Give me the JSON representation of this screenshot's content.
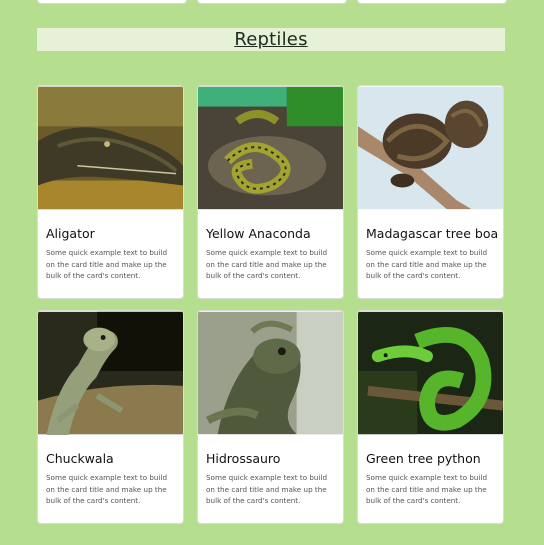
{
  "section": {
    "title": "Reptiles"
  },
  "cards": [
    {
      "title": "Aligator",
      "text": "Some quick example text to build on the card title and make up the bulk of the card's content.",
      "image": "alligator-photo"
    },
    {
      "title": "Yellow Anaconda",
      "text": "Some quick example text to build on the card title and make up the bulk of the card's content.",
      "image": "anaconda-photo"
    },
    {
      "title": "Madagascar tree boa",
      "text": "Some quick example text to build on the card title and make up the bulk of the card's content.",
      "image": "tree-boa-photo"
    },
    {
      "title": "Chuckwala",
      "text": "Some quick example text to build on the card title and make up the bulk of the card's content.",
      "image": "chuckwala-photo"
    },
    {
      "title": "Hidrossauro",
      "text": "Some quick example text to build on the card title and make up the bulk of the card's content.",
      "image": "hidrossauro-photo"
    },
    {
      "title": "Green tree python",
      "text": "Some quick example text to build on the card title and make up the bulk of the card's content.",
      "image": "green-python-photo"
    }
  ],
  "colors": {
    "page_background": "#b5df8f",
    "header_background": "#e6f1d8",
    "card_background": "#ffffff"
  }
}
